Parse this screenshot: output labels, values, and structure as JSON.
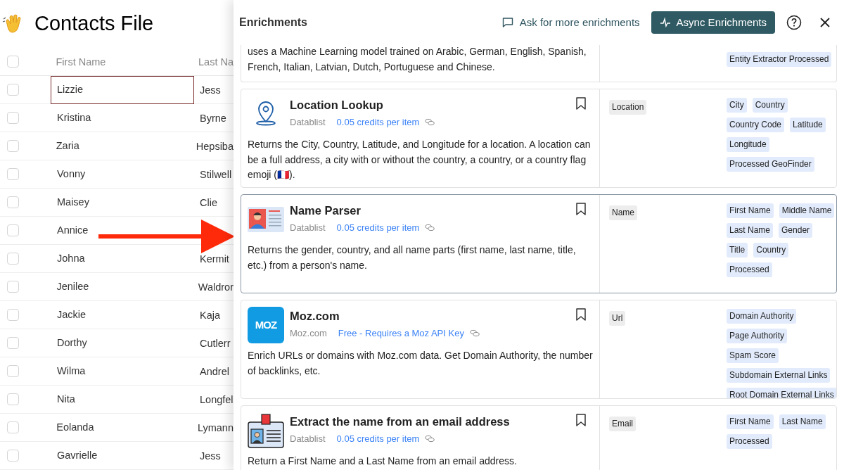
{
  "page": {
    "title": "Contacts File"
  },
  "table": {
    "all_checked": false,
    "columns": [
      "First Name",
      "Last Na"
    ],
    "rows": [
      {
        "checked": false,
        "first_name": "Lizzie",
        "last_name": "Jess",
        "focused": true
      },
      {
        "checked": false,
        "first_name": "Kristina",
        "last_name": "Byrne",
        "focused": false
      },
      {
        "checked": false,
        "first_name": "Zaria",
        "last_name": "Hepsiba",
        "focused": false
      },
      {
        "checked": false,
        "first_name": "Vonny",
        "last_name": "Stilwell",
        "focused": false
      },
      {
        "checked": false,
        "first_name": "Maisey",
        "last_name": "Clie",
        "focused": false
      },
      {
        "checked": false,
        "first_name": "Annice",
        "focused": false
      },
      {
        "checked": false,
        "first_name": "Johna",
        "last_name": "Kermit",
        "focused": false
      },
      {
        "checked": false,
        "first_name": "Jenilee",
        "last_name": "Waldror",
        "focused": false
      },
      {
        "checked": false,
        "first_name": "Jackie",
        "last_name": "Kaja",
        "focused": false
      },
      {
        "checked": false,
        "first_name": "Dorthy",
        "last_name": "Cutlerr",
        "focused": false
      },
      {
        "checked": false,
        "first_name": "Wilma",
        "last_name": "Andrel",
        "focused": false
      },
      {
        "checked": false,
        "first_name": "Nita",
        "last_name": "Longfel",
        "focused": false
      },
      {
        "checked": false,
        "first_name": "Eolanda",
        "last_name": "Lymann",
        "focused": false
      },
      {
        "checked": false,
        "first_name": "Gavrielle",
        "last_name": "Jess",
        "focused": false
      }
    ]
  },
  "panel": {
    "title": "Enrichments",
    "ask_link": "Ask for more enrichments",
    "async_button": "Async Enrichments",
    "cards": [
      {
        "kind": "partial",
        "highlighted": false,
        "description": "uses a Machine Learning model trained on Arabic, German, English, Spanish, French, Italian, Latvian, Dutch, Portuguese and Chinese.",
        "outputs": [
          "Entity Extractor Processed"
        ]
      },
      {
        "kind": "location",
        "highlighted": false,
        "title": "Location Lookup",
        "provider": "Datablist",
        "price": "0.05 credits per item",
        "description": "Returns the City, Country, Latitude, and Longitude for a location. A location can be a full address, a city with or without the country, a country, or a country flag emoji (🇫🇷).",
        "inputs": [
          "Location"
        ],
        "outputs": [
          "City",
          "Country",
          "Country Code",
          "Latitude",
          "Longitude",
          "Processed GeoFinder"
        ]
      },
      {
        "kind": "name_parser",
        "highlighted": true,
        "title": "Name Parser",
        "provider": "Datablist",
        "price": "0.05 credits per item",
        "description": "Returns the gender, country, and all name parts (first name, last name, title, etc.) from a person's name.",
        "inputs": [
          "Name"
        ],
        "outputs": [
          "First Name",
          "Middle Name",
          "Last Name",
          "Gender",
          "Title",
          "Country",
          "Processed"
        ]
      },
      {
        "kind": "moz",
        "logo_text": "MOZ",
        "highlighted": false,
        "title": "Moz.com",
        "provider": "Moz.com",
        "price": "Free - Requires a Moz API Key",
        "description": "Enrich URLs or domains with Moz.com data. Get Domain Authority, the number of backlinks, etc.",
        "inputs": [
          "Url"
        ],
        "outputs": [
          "Domain Authority",
          "Page Authority",
          "Spam Score",
          "Subdomain External Links",
          "Root Domain External Links"
        ]
      },
      {
        "kind": "email",
        "highlighted": false,
        "title": "Extract the name from an email address",
        "provider": "Datablist",
        "price": "0.05 credits per item",
        "description": "Return a First Name and a Last Name from an email address.",
        "inputs": [
          "Email"
        ],
        "outputs": [
          "First Name",
          "Last Name",
          "Processed"
        ]
      }
    ]
  }
}
